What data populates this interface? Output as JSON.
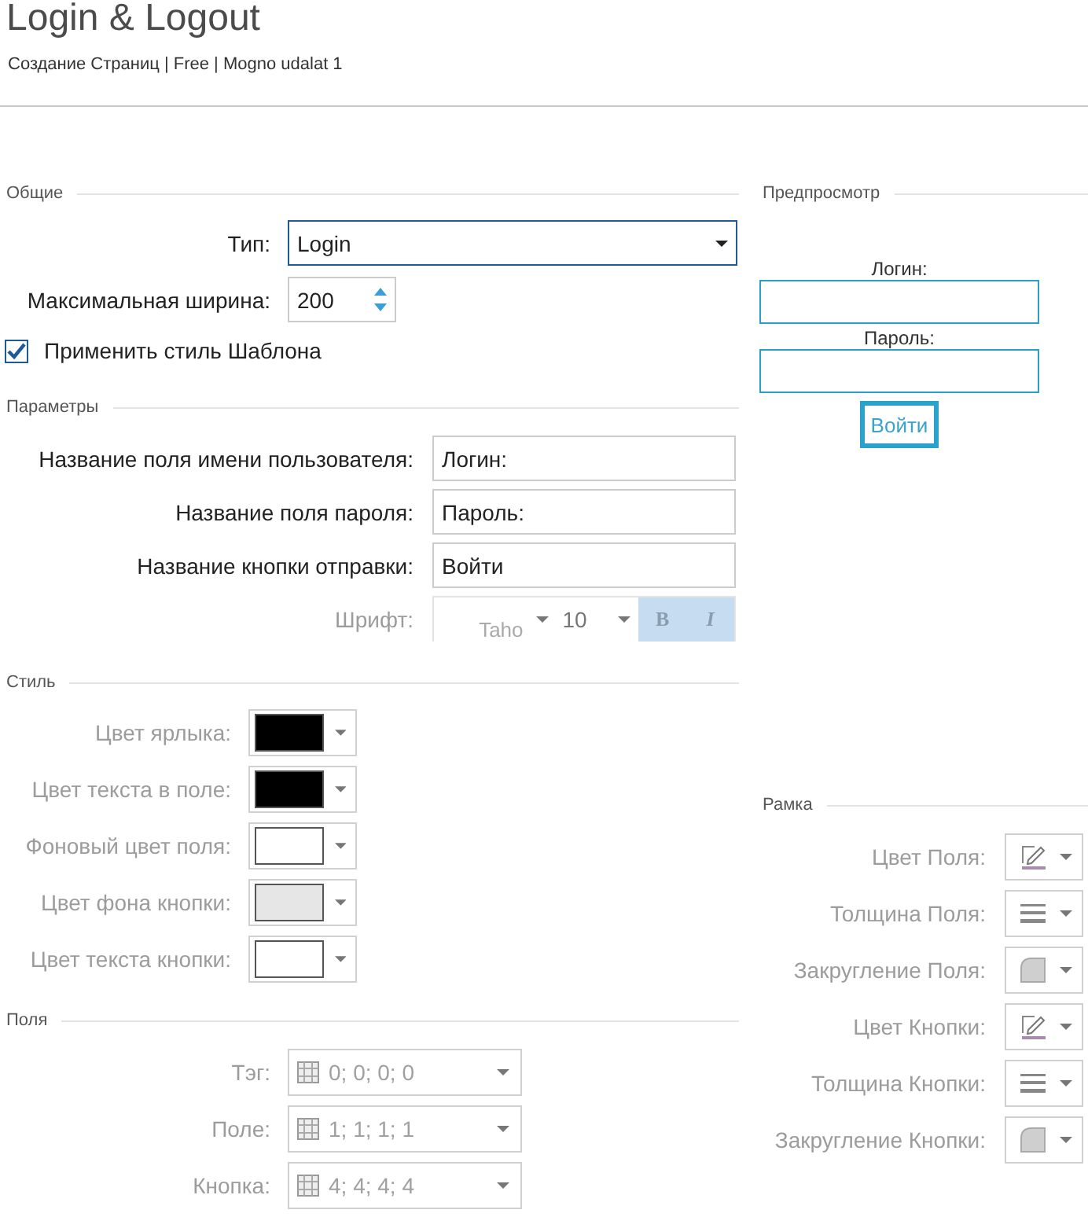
{
  "header": {
    "title": "Login & Logout",
    "subtitle": "Создание Страниц | Free | Mogno udalat 1"
  },
  "general": {
    "title": "Общие",
    "type": {
      "label": "Тип:",
      "value": "Login"
    },
    "max_width": {
      "label": "Максимальная ширина:",
      "value": "200"
    },
    "apply_template_style": {
      "label": "Применить стиль Шаблона",
      "checked": true
    }
  },
  "parameters": {
    "title": "Параметры",
    "fields": [
      {
        "label": "Название поля имени пользователя:",
        "value": "Логин:"
      },
      {
        "label": "Название поля пароля:",
        "value": "Пароль:"
      },
      {
        "label": "Название кнопки отправки:",
        "value": "Войти"
      }
    ],
    "font": {
      "label": "Шрифт:",
      "disabled": true,
      "family": "Taho",
      "size": "10",
      "bold": "B",
      "italic": "I"
    }
  },
  "style": {
    "title": "Стиль",
    "colors": [
      {
        "label": "Цвет ярлыка:",
        "color": "#000000",
        "disabled": true
      },
      {
        "label": "Цвет текста в поле:",
        "color": "#000000",
        "disabled": true
      },
      {
        "label": "Фоновый цвет поля:",
        "color": "#ffffff",
        "disabled": true
      },
      {
        "label": "Цвет фона кнопки:",
        "color": "#e6e6e6",
        "disabled": true
      },
      {
        "label": "Цвет текста кнопки:",
        "color": "#ffffff",
        "disabled": true
      }
    ]
  },
  "fields": {
    "title": "Поля",
    "paddings": [
      {
        "label": "Тэг:",
        "value": "0; 0; 0; 0",
        "disabled": true
      },
      {
        "label": "Поле:",
        "value": "1; 1; 1; 1",
        "disabled": true
      },
      {
        "label": "Кнопка:",
        "value": "4; 4; 4; 4",
        "disabled": true
      }
    ]
  },
  "preview": {
    "title": "Предпросмотр",
    "inputs": [
      {
        "label": "Логин:"
      },
      {
        "label": "Пароль:"
      }
    ],
    "submit": "Войти"
  },
  "border": {
    "title": "Рамка",
    "items": [
      {
        "label": "Цвет Поля:",
        "kind": "color",
        "disabled": true
      },
      {
        "label": "Толщина Поля:",
        "kind": "thickness",
        "disabled": true
      },
      {
        "label": "Закругление Поля:",
        "kind": "radius",
        "disabled": true
      },
      {
        "label": "Цвет Кнопки:",
        "kind": "color",
        "disabled": true
      },
      {
        "label": "Толщина Кнопки:",
        "kind": "thickness",
        "disabled": true
      },
      {
        "label": "Закругление Кнопки:",
        "kind": "radius",
        "disabled": true
      }
    ]
  }
}
